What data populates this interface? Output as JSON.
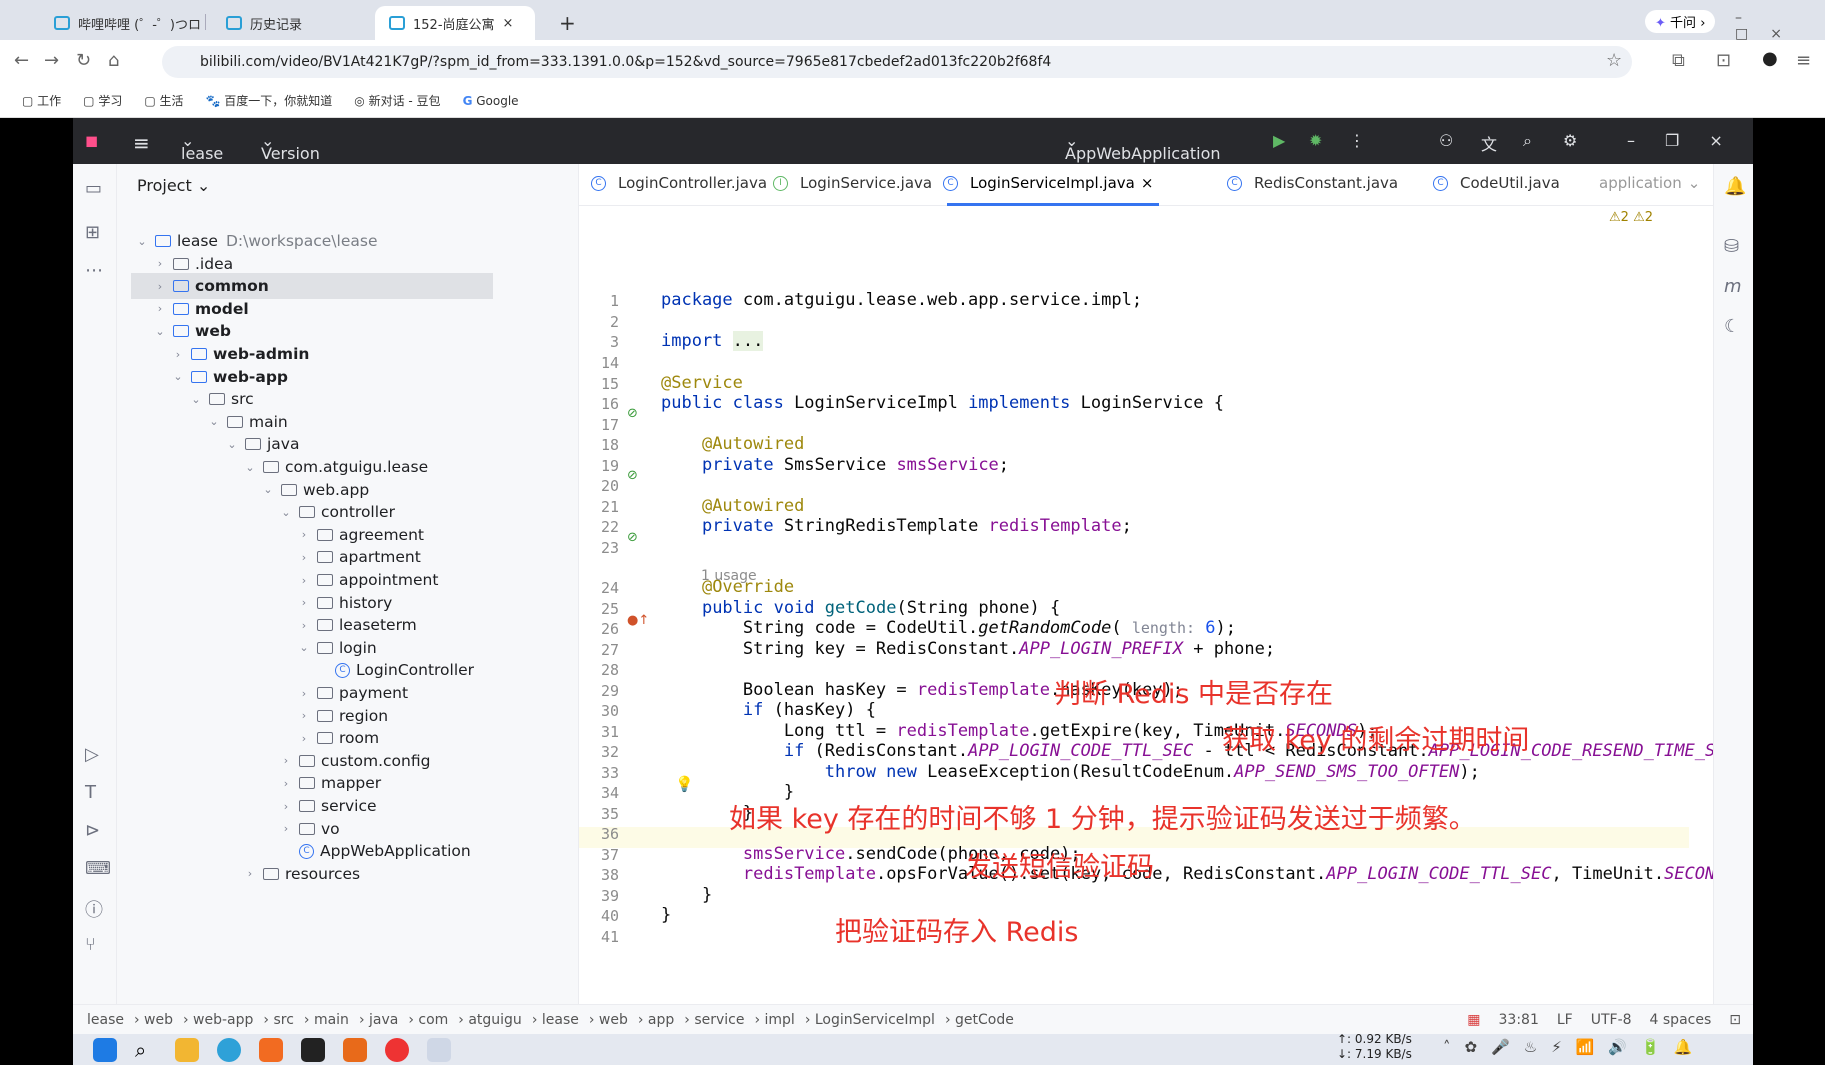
{
  "browser": {
    "tabs": [
      {
        "label": "哔哩哔哩 (゜-゜)つロ"
      },
      {
        "label": "历史记录"
      },
      {
        "label": "152-尚庭公寓"
      }
    ],
    "new_tab": "+",
    "qianwen": "千问",
    "url": "bilibili.com/video/BV1At421K7gP/?spm_id_from=333.1391.0.0&p=152&vd_source=7965e817cbedef2ad013fc220b2f68f4",
    "bookmarks": [
      "工作",
      "学习",
      "生活",
      "百度一下，你就知道",
      "新对话 - 豆包",
      "Google"
    ]
  },
  "ide": {
    "project_name": "lease",
    "menu": "Version control",
    "run_config": "AppWebApplication",
    "panel_title": "Project",
    "tree": [
      {
        "label": "lease",
        "hint": "D:\\workspace\\lease",
        "depth": 0,
        "chev": "v",
        "icon": "module"
      },
      {
        "label": ".idea",
        "depth": 1,
        "chev": ">",
        "icon": "folder"
      },
      {
        "label": "common",
        "depth": 1,
        "chev": ">",
        "icon": "module",
        "bold": true,
        "selected": true
      },
      {
        "label": "model",
        "depth": 1,
        "chev": ">",
        "icon": "module",
        "bold": true
      },
      {
        "label": "web",
        "depth": 1,
        "chev": "v",
        "icon": "module",
        "bold": true
      },
      {
        "label": "web-admin",
        "depth": 2,
        "chev": ">",
        "icon": "module",
        "bold": true
      },
      {
        "label": "web-app",
        "depth": 2,
        "chev": "v",
        "icon": "module",
        "bold": true
      },
      {
        "label": "src",
        "depth": 3,
        "chev": "v",
        "icon": "folder"
      },
      {
        "label": "main",
        "depth": 4,
        "chev": "v",
        "icon": "folder"
      },
      {
        "label": "java",
        "depth": 5,
        "chev": "v",
        "icon": "folder"
      },
      {
        "label": "com.atguigu.lease",
        "depth": 6,
        "chev": "v",
        "icon": "package"
      },
      {
        "label": "web.app",
        "depth": 7,
        "chev": "v",
        "icon": "package"
      },
      {
        "label": "controller",
        "depth": 8,
        "chev": "v",
        "icon": "package"
      },
      {
        "label": "agreement",
        "depth": 9,
        "chev": ">",
        "icon": "package"
      },
      {
        "label": "apartment",
        "depth": 9,
        "chev": ">",
        "icon": "package"
      },
      {
        "label": "appointment",
        "depth": 9,
        "chev": ">",
        "icon": "package"
      },
      {
        "label": "history",
        "depth": 9,
        "chev": ">",
        "icon": "package"
      },
      {
        "label": "leaseterm",
        "depth": 9,
        "chev": ">",
        "icon": "package"
      },
      {
        "label": "login",
        "depth": 9,
        "chev": "v",
        "icon": "package"
      },
      {
        "label": "LoginController",
        "depth": 10,
        "chev": "",
        "icon": "class"
      },
      {
        "label": "payment",
        "depth": 9,
        "chev": ">",
        "icon": "package"
      },
      {
        "label": "region",
        "depth": 9,
        "chev": ">",
        "icon": "package"
      },
      {
        "label": "room",
        "depth": 9,
        "chev": ">",
        "icon": "package"
      },
      {
        "label": "custom.config",
        "depth": 8,
        "chev": ">",
        "icon": "package"
      },
      {
        "label": "mapper",
        "depth": 8,
        "chev": ">",
        "icon": "package"
      },
      {
        "label": "service",
        "depth": 8,
        "chev": ">",
        "icon": "package"
      },
      {
        "label": "vo",
        "depth": 8,
        "chev": ">",
        "icon": "package"
      },
      {
        "label": "AppWebApplication",
        "depth": 8,
        "chev": "",
        "icon": "class"
      },
      {
        "label": "resources",
        "depth": 6,
        "chev": ">",
        "icon": "folder"
      }
    ],
    "editor_tabs": [
      "LoginController.java",
      "LoginService.java",
      "LoginServiceImpl.java",
      "RedisConstant.java",
      "CodeUtil.java",
      "application"
    ],
    "inspections": "⚠2 ⚠2",
    "usage_hint": "1 usage",
    "code": [
      {
        "n": "1",
        "html": "<span class='kw'>package</span> com.atguigu.lease.web.app.service.impl;"
      },
      {
        "n": "2",
        "html": ""
      },
      {
        "n": "3",
        "html": "<span class='kw'>import</span> <span style='background:#e8f2e1'>...</span>"
      },
      {
        "n": "14",
        "html": ""
      },
      {
        "n": "15",
        "html": "<span class='an'>@Service</span>"
      },
      {
        "n": "16",
        "html": "<span class='kw'>public class</span> LoginServiceImpl <span class='kw'>implements</span> LoginService {"
      },
      {
        "n": "17",
        "html": ""
      },
      {
        "n": "18",
        "html": "    <span class='an'>@Autowired</span>"
      },
      {
        "n": "19",
        "html": "    <span class='kw'>private</span> SmsService <span class='fd'>smsService</span>;"
      },
      {
        "n": "20",
        "html": ""
      },
      {
        "n": "21",
        "html": "    <span class='an'>@Autowired</span>"
      },
      {
        "n": "22",
        "html": "    <span class='kw'>private</span> StringRedisTemplate <span class='fd'>redisTemplate</span>;"
      },
      {
        "n": "23",
        "html": ""
      },
      {
        "n": "24",
        "html": "    <span class='an'>@Override</span>"
      },
      {
        "n": "25",
        "html": "    <span class='kw'>public void</span> <span class='fn'>getCode</span>(String phone) {"
      },
      {
        "n": "26",
        "html": "        String code = CodeUtil.<i>getRandomCode</i>( <span class='ih'>length:</span> <span class='num'>6</span>);"
      },
      {
        "n": "27",
        "html": "        String key = RedisConstant.<span class='st'>APP_LOGIN_PREFIX</span> + phone;"
      },
      {
        "n": "28",
        "html": ""
      },
      {
        "n": "29",
        "html": "        Boolean hasKey = <span class='fd'>redisTemplate</span>.hasKey(key);"
      },
      {
        "n": "30",
        "html": "        <span class='kw'>if</span> (hasKey) {"
      },
      {
        "n": "31",
        "html": "            Long ttl = <span class='fd'>redisTemplate</span>.getExpire(key, TimeUnit.<span class='st'>SECONDS</span>);"
      },
      {
        "n": "32",
        "html": "            <span class='kw'>if</span> (RedisConstant.<span class='st'>APP_LOGIN_CODE_TTL_SEC</span> - ttl < RedisConstant.<span class='st'>APP_LOGIN_CODE_RESEND_TIME_SEC</span>)"
      },
      {
        "n": "33",
        "html": "                <span class='kw'>throw new</span> LeaseException(ResultCodeEnum.<span class='st'>APP_SEND_SMS_TOO_OFTEN</span>);"
      },
      {
        "n": "34",
        "html": "            }"
      },
      {
        "n": "35",
        "html": "        }"
      },
      {
        "n": "36",
        "html": ""
      },
      {
        "n": "37",
        "html": "        <span class='fd'>smsService</span>.sendCode(phone, code);"
      },
      {
        "n": "38",
        "html": "        <span class='fd'>redisTemplate</span>.opsForValue().set(key, code, RedisConstant.<span class='st'>APP_LOGIN_CODE_TTL_SEC</span>, TimeUnit.<span class='st'>SECONDS</span>);"
      },
      {
        "n": "39",
        "html": "    }"
      },
      {
        "n": "40",
        "html": "}"
      },
      {
        "n": "41",
        "html": ""
      }
    ],
    "annotations": {
      "a1": "判断 Redis 中是否存在",
      "a2": "获取 key 的剩余过期时间",
      "a3": "如果 key 存在的时间不够 1 分钟，提示验证码发送过于频繁。",
      "a4": "发送短信验证码",
      "a5": "把验证码存入 Redis"
    },
    "breadcrumb": [
      "lease",
      "web",
      "web-app",
      "src",
      "main",
      "java",
      "com",
      "atguigu",
      "lease",
      "web",
      "app",
      "service",
      "impl",
      "LoginServiceImpl",
      "getCode"
    ],
    "status": {
      "position": "33:81",
      "line_sep": "LF",
      "encoding": "UTF-8",
      "indent": "4 spaces"
    },
    "net": {
      "up": "↑: 0.92 KB/s",
      "down": "↓: 7.19 KB/s"
    }
  }
}
